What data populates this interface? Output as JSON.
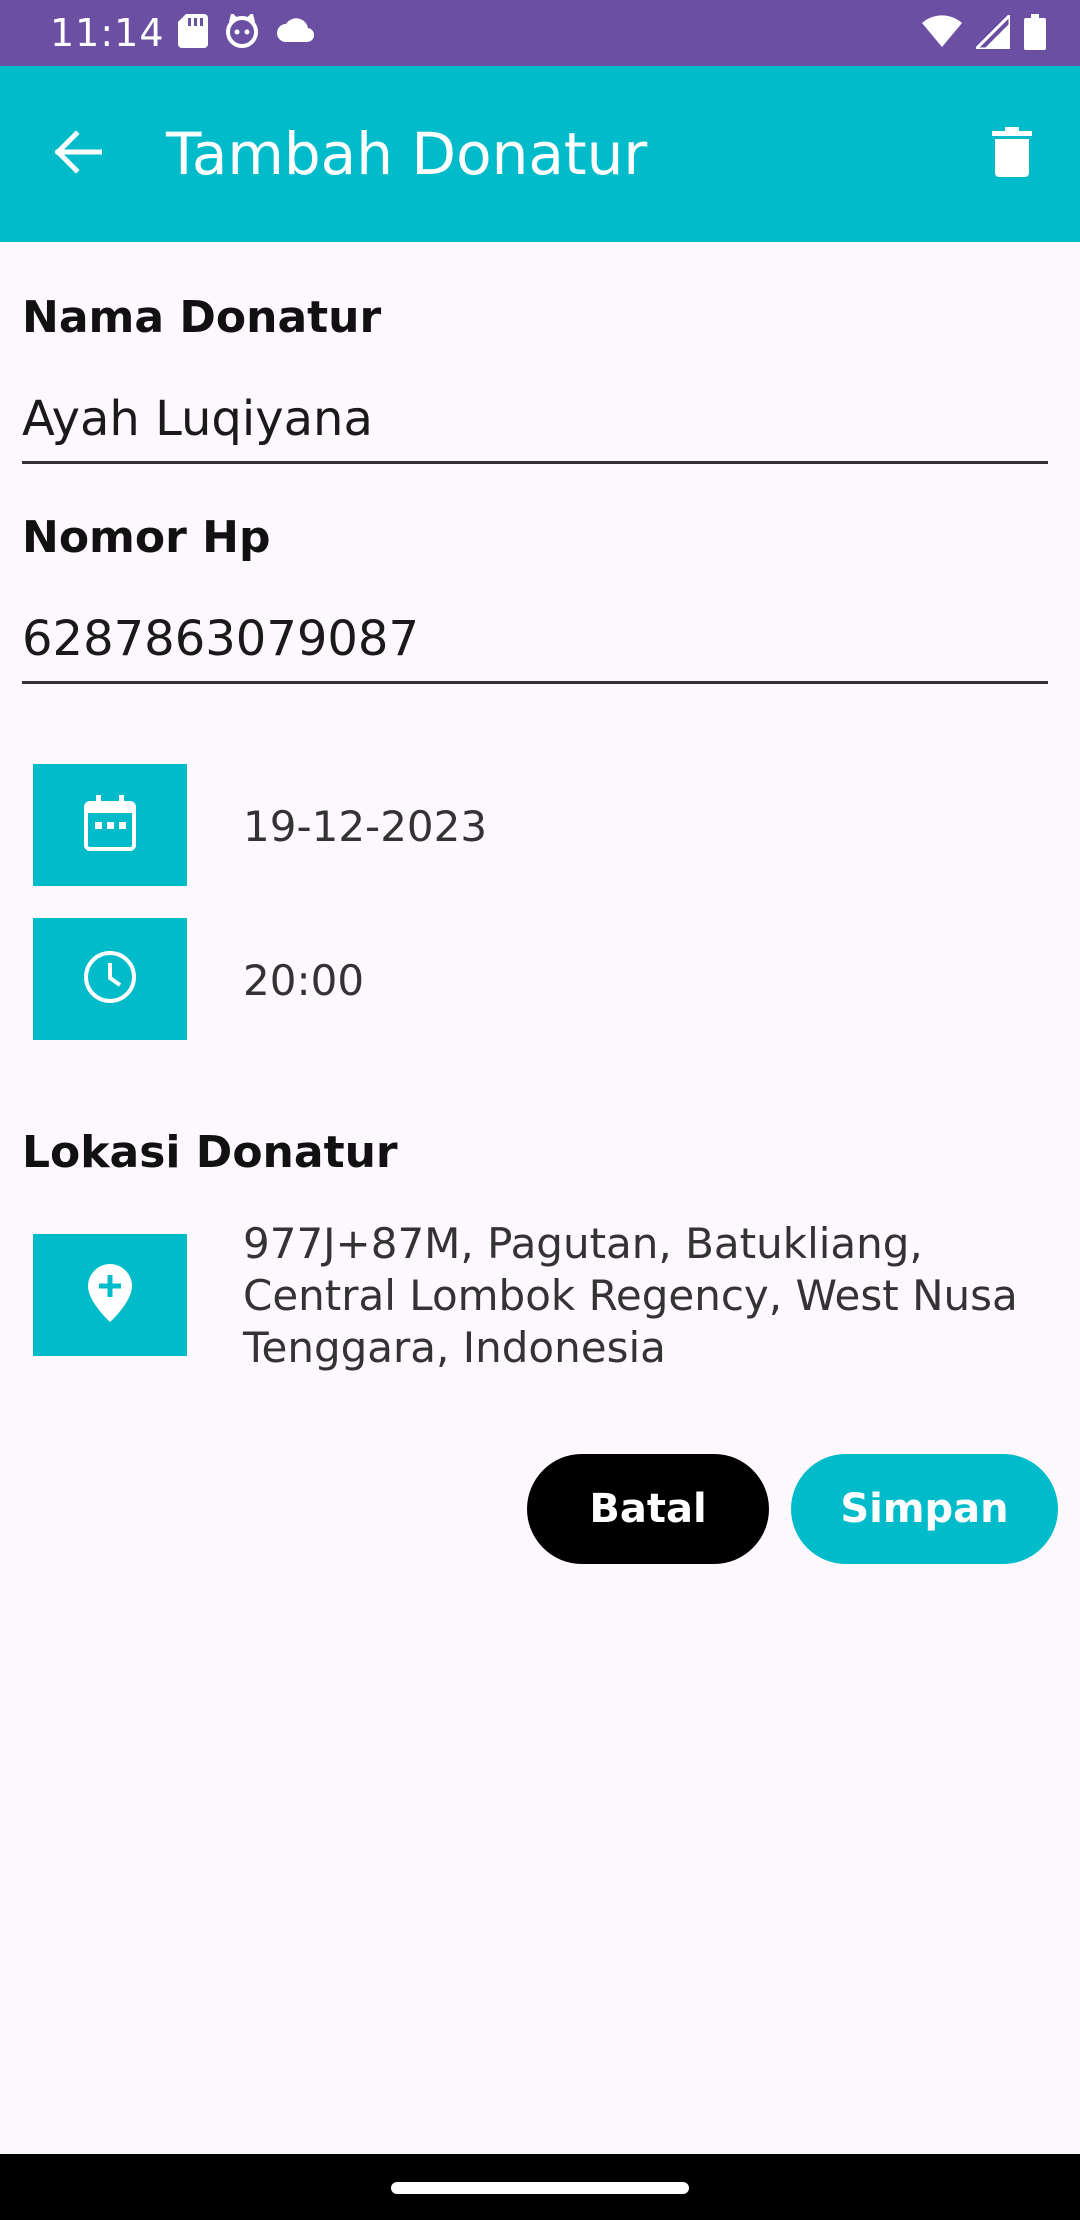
{
  "status_bar": {
    "time": "11:14",
    "left_icons": [
      "sd-card-icon",
      "cat-face-icon",
      "cloud-icon"
    ],
    "right_icons": [
      "wifi-icon",
      "signal-icon",
      "battery-icon"
    ]
  },
  "app_bar": {
    "title": "Tambah Donatur",
    "color": "#00bcca"
  },
  "form": {
    "name_label": "Nama Donatur",
    "name_value": "Ayah Luqiyana",
    "phone_label": "Nomor Hp",
    "phone_value": "6287863079087",
    "date_value": "19-12-2023",
    "time_value": "20:00",
    "location_label": "Lokasi Donatur",
    "location_value": "977J+87M, Pagutan, Batukliang, Central Lombok Regency, West Nusa Tenggara, Indonesia"
  },
  "actions": {
    "cancel_label": "Batal",
    "save_label": "Simpan"
  },
  "colors": {
    "status_bar": "#6a4fa2",
    "accent": "#00bcca",
    "background": "#fdf8fd",
    "cancel_button": "#000000"
  }
}
